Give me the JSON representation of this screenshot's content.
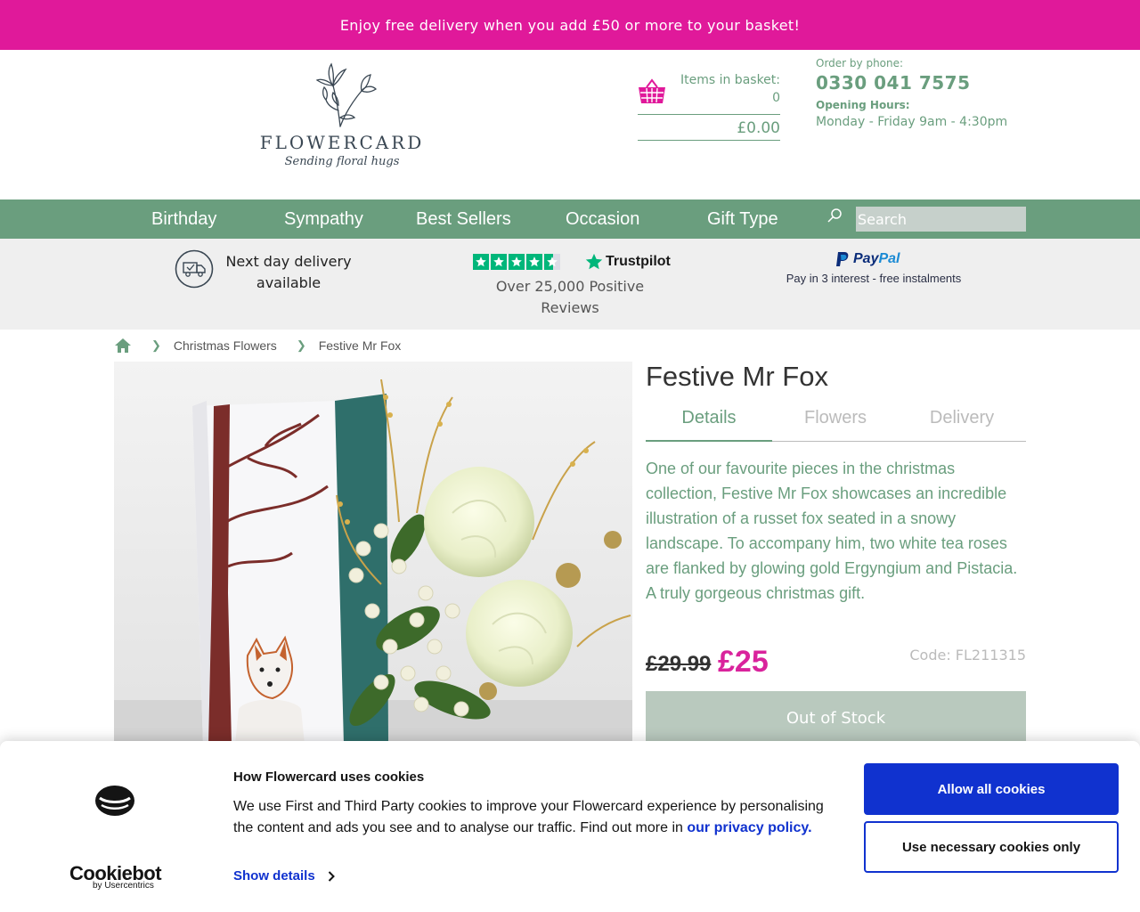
{
  "promo": {
    "text": "Enjoy free delivery when you add £50 or more to your basket!"
  },
  "header": {
    "brand": "FLOWERCARD",
    "tagline": "Sending floral hugs",
    "basket": {
      "items_label": "Items in basket:",
      "items_count": "0",
      "total": "£0.00"
    },
    "contact": {
      "order_label": "Order by phone:",
      "phone": "0330 041 7575",
      "hours_label": "Opening Hours:",
      "hours": "Monday - Friday 9am - 4:30pm"
    }
  },
  "nav": {
    "items": [
      {
        "label": "Birthday"
      },
      {
        "label": "Sympathy"
      },
      {
        "label": "Best Sellers"
      },
      {
        "label": "Occasion"
      },
      {
        "label": "Gift Type"
      }
    ],
    "search_placeholder": "Search"
  },
  "trust": {
    "delivery_text": "Next day delivery available",
    "trustpilot_name": "Trustpilot",
    "trustpilot_rating": 4.5,
    "reviews_text": "Over 25,000 Positive Reviews",
    "paypal_word_a": "Pay",
    "paypal_word_b": "Pal",
    "paypal_sub": "Pay in 3 interest - free instalments"
  },
  "breadcrumb": {
    "items": [
      "Christmas Flowers",
      "Festive Mr Fox"
    ]
  },
  "product": {
    "title": "Festive Mr Fox",
    "tabs": [
      {
        "label": "Details"
      },
      {
        "label": "Flowers"
      },
      {
        "label": "Delivery"
      }
    ],
    "active_tab": "Details",
    "description": "One of our favourite pieces in the christmas collection, Festive Mr Fox showcases an incredible illustration of a russet fox seated in a snowy landscape. To accompany him, two white tea roses are flanked by glowing gold Ergyngium and Pistacia. A truly gorgeous christmas gift.",
    "old_price": "£29.99",
    "new_price": "£25",
    "code": "Code: FL211315",
    "stock_button": "Out of Stock"
  },
  "cookie": {
    "logo_word": "Cookiebot",
    "logo_by": "by Usercentrics",
    "title": "How Flowercard uses cookies",
    "text": "We use First and Third Party cookies to improve your Flowercard experience by personalising the content and ads you see and to analyse our traffic. Find out more in ",
    "privacy_link": "our privacy policy.",
    "show_details": "Show details",
    "allow_all": "Allow all cookies",
    "necessary_only": "Use necessary cookies only"
  },
  "colors": {
    "brand_pink": "#e0199a",
    "brand_green": "#6a9e7e",
    "price_pink": "#d9239c",
    "cookiebot_blue": "#1032cf",
    "trustpilot_green": "#00b67a"
  }
}
